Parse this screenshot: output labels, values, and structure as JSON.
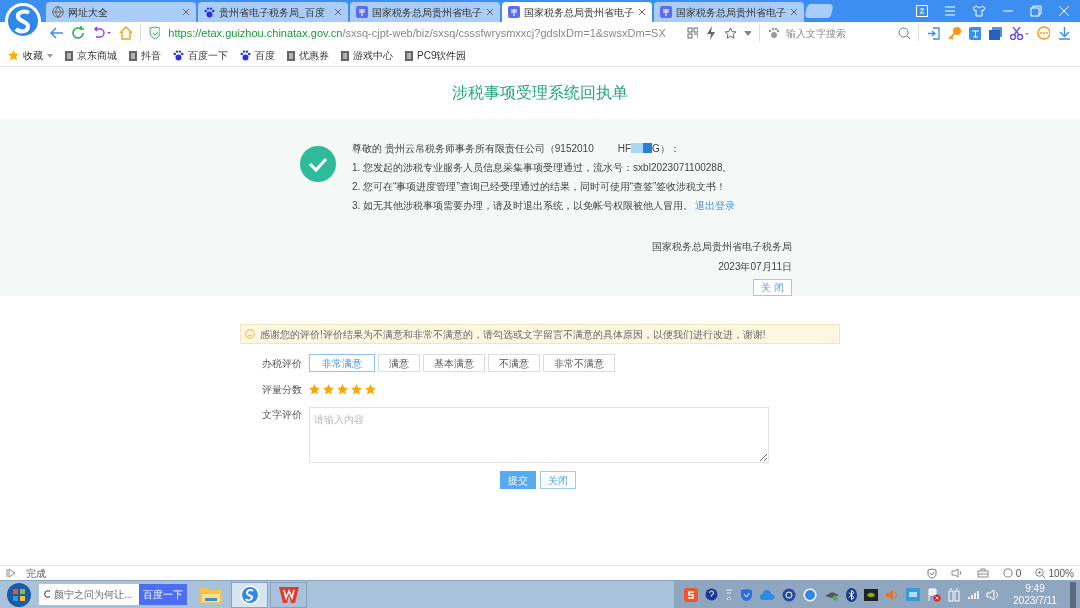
{
  "browser": {
    "tabs": [
      {
        "label": "网址大全",
        "kind": "globe",
        "selected": false
      },
      {
        "label": "贵州省电子税务局_百度",
        "kind": "paw",
        "selected": false
      },
      {
        "label": "国家税务总局贵州省电子",
        "kind": "tax",
        "selected": false
      },
      {
        "label": "国家税务总局贵州省电子",
        "kind": "tax",
        "selected": true
      },
      {
        "label": "国家税务总局贵州省电子",
        "kind": "tax",
        "selected": false
      }
    ],
    "url": {
      "host": "https://etax.guizhou.chinatax.gov.cn",
      "path": "/sxsq-cjpt-web/biz/sxsq/csssfwrysmxxcj?gdslxDm=1&swsxDm=SX"
    },
    "search": {
      "placeholder": "输入文字搜索"
    },
    "bookmarks": [
      {
        "label": "收藏",
        "kind": "star"
      },
      {
        "label": "京东商城",
        "kind": "page"
      },
      {
        "label": "抖音",
        "kind": "page"
      },
      {
        "label": "百度一下",
        "kind": "paw"
      },
      {
        "label": "百度",
        "kind": "paw"
      },
      {
        "label": "优惠券",
        "kind": "page"
      },
      {
        "label": "游戏中心",
        "kind": "page"
      },
      {
        "label": "PC9软件园",
        "kind": "page"
      }
    ]
  },
  "page": {
    "title": "涉税事项受理系统回执单",
    "greeting": {
      "before": "尊敬的 贵州云帛税务师事务所有限责任公司（9152010",
      "middle": "HF",
      "after": "G）："
    },
    "lines": [
      "1. 您发起的涉税专业服务人员信息采集事项受理通过，流水号：sxbl2023071100288。",
      "2. 您可在“事项进度管理”查询已经受理通过的结果，同时可使用“查签”签收涉税文书！",
      "3. 如无其他涉税事项需要办理，请及时退出系统，以免帐号权限被他人冒用。"
    ],
    "logout_link": "退出登录",
    "issuer": "国家税务总局贵州省电子税务局",
    "date": "2023年07月11日",
    "close_button": "关 闭"
  },
  "feedback": {
    "notice": "感谢您的评价!评价结果为不满意和非常不满意的，请勾选或文字留言不满意的具体原因，以便我们进行改进，谢谢!",
    "rating_label": "办税评价",
    "options": [
      {
        "label": "非常满意",
        "selected": true
      },
      {
        "label": "满意",
        "selected": false
      },
      {
        "label": "基本满意",
        "selected": false
      },
      {
        "label": "不满意",
        "selected": false
      },
      {
        "label": "非常不满意",
        "selected": false
      }
    ],
    "score_label": "评量分数",
    "stars": 5,
    "comment_label": "文字评价",
    "comment": {
      "placeholder": "请输入内容"
    },
    "submit": "提交",
    "close": "关闭"
  },
  "status_bar": {
    "text": "完成",
    "block_count": "0",
    "zoom": "100%"
  },
  "taskbar": {
    "search": {
      "placeholder": "颜宁之问为何让..."
    },
    "search_button": "百度一下",
    "time": "9:49",
    "date": "2023/7/11"
  }
}
